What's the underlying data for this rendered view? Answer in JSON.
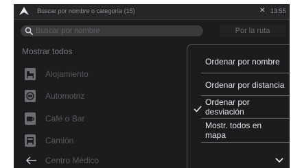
{
  "titlebar": {
    "title": "Buscar por nombre o categoría (15)",
    "close": "✕",
    "time": "13:55"
  },
  "search": {
    "placeholder": "Buscar por nombre",
    "value": ""
  },
  "route_button": "Por la ruta",
  "show_all": "Mostrar todos",
  "categories": [
    {
      "label": "Alojamiento",
      "icon": "bed-icon"
    },
    {
      "label": "Automotriz",
      "icon": "car-icon"
    },
    {
      "label": "Café o Bar",
      "icon": "coffee-icon"
    },
    {
      "label": "Camión",
      "icon": "truck-icon"
    },
    {
      "label": "Centro Médico",
      "icon": "medical-icon"
    }
  ],
  "sort_menu": {
    "items": [
      {
        "label": "Ordenar por nombre",
        "checked": false
      },
      {
        "label": "Ordenar por distancia",
        "checked": false
      },
      {
        "label": "Ordenar por\ndesviación",
        "checked": true
      },
      {
        "label": "Mostr. todos en\nmapa",
        "checked": false
      }
    ]
  },
  "colors": {
    "background": "#1c1c1e",
    "titlebar": "#262628",
    "menu_text": "#e5e5ea",
    "muted_text": "#5a5a5e"
  }
}
